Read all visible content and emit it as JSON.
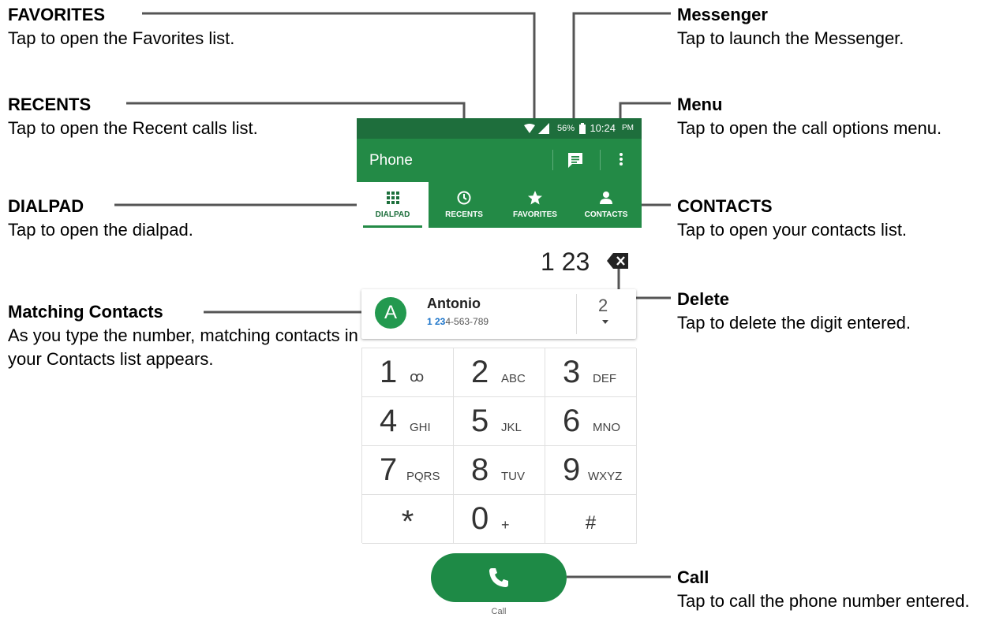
{
  "callouts": {
    "favorites": {
      "title": "FAVORITES",
      "desc": "Tap to open the Favorites list."
    },
    "recents": {
      "title": "RECENTS",
      "desc": "Tap to open the Recent calls list."
    },
    "dialpad": {
      "title": "DIALPAD",
      "desc": "Tap to open the dialpad."
    },
    "matching": {
      "title": "Matching Contacts",
      "desc": "As you type the number, matching contacts in your Contacts list appears."
    },
    "messenger": {
      "title": "Messenger",
      "desc": "Tap to launch the Messenger."
    },
    "menu": {
      "title": "Menu",
      "desc": "Tap to open the call options menu."
    },
    "contacts": {
      "title": "CONTACTS",
      "desc": "Tap to open your contacts list."
    },
    "delete": {
      "title": "Delete",
      "desc": "Tap to delete the digit entered."
    },
    "call": {
      "title": "Call",
      "desc": "Tap to call the phone number entered."
    }
  },
  "status_bar": {
    "battery": "56%",
    "time": "10:24",
    "ampm": "PM"
  },
  "app_bar": {
    "title": "Phone"
  },
  "tabs": [
    {
      "label": "DIALPAD",
      "icon": "dialpad-icon",
      "active": true
    },
    {
      "label": "RECENTS",
      "icon": "clock-icon"
    },
    {
      "label": "FAVORITES",
      "icon": "star-icon"
    },
    {
      "label": "CONTACTS",
      "icon": "person-icon"
    }
  ],
  "dialed_number": "1 23",
  "match": {
    "avatar_letter": "A",
    "name": "Antonio",
    "number_highlight": "1 23",
    "number_rest": "4-563-789",
    "count": "2"
  },
  "keypad": [
    {
      "digit": "1",
      "letters": "ꝏ"
    },
    {
      "digit": "2",
      "letters": "ABC"
    },
    {
      "digit": "3",
      "letters": "DEF"
    },
    {
      "digit": "4",
      "letters": "GHI"
    },
    {
      "digit": "5",
      "letters": "JKL"
    },
    {
      "digit": "6",
      "letters": "MNO"
    },
    {
      "digit": "7",
      "letters": "PQRS"
    },
    {
      "digit": "8",
      "letters": "TUV"
    },
    {
      "digit": "9",
      "letters": "WXYZ"
    },
    {
      "digit": "*",
      "letters": ""
    },
    {
      "digit": "0",
      "letters": "+"
    },
    {
      "digit": "#",
      "letters": ""
    }
  ],
  "call": {
    "label": "Call"
  },
  "colors": {
    "appbar": "#238a46",
    "statusbar": "#1e6e3c",
    "call": "#1e8a46",
    "highlight": "#1a73c9",
    "leader": "#555555"
  }
}
